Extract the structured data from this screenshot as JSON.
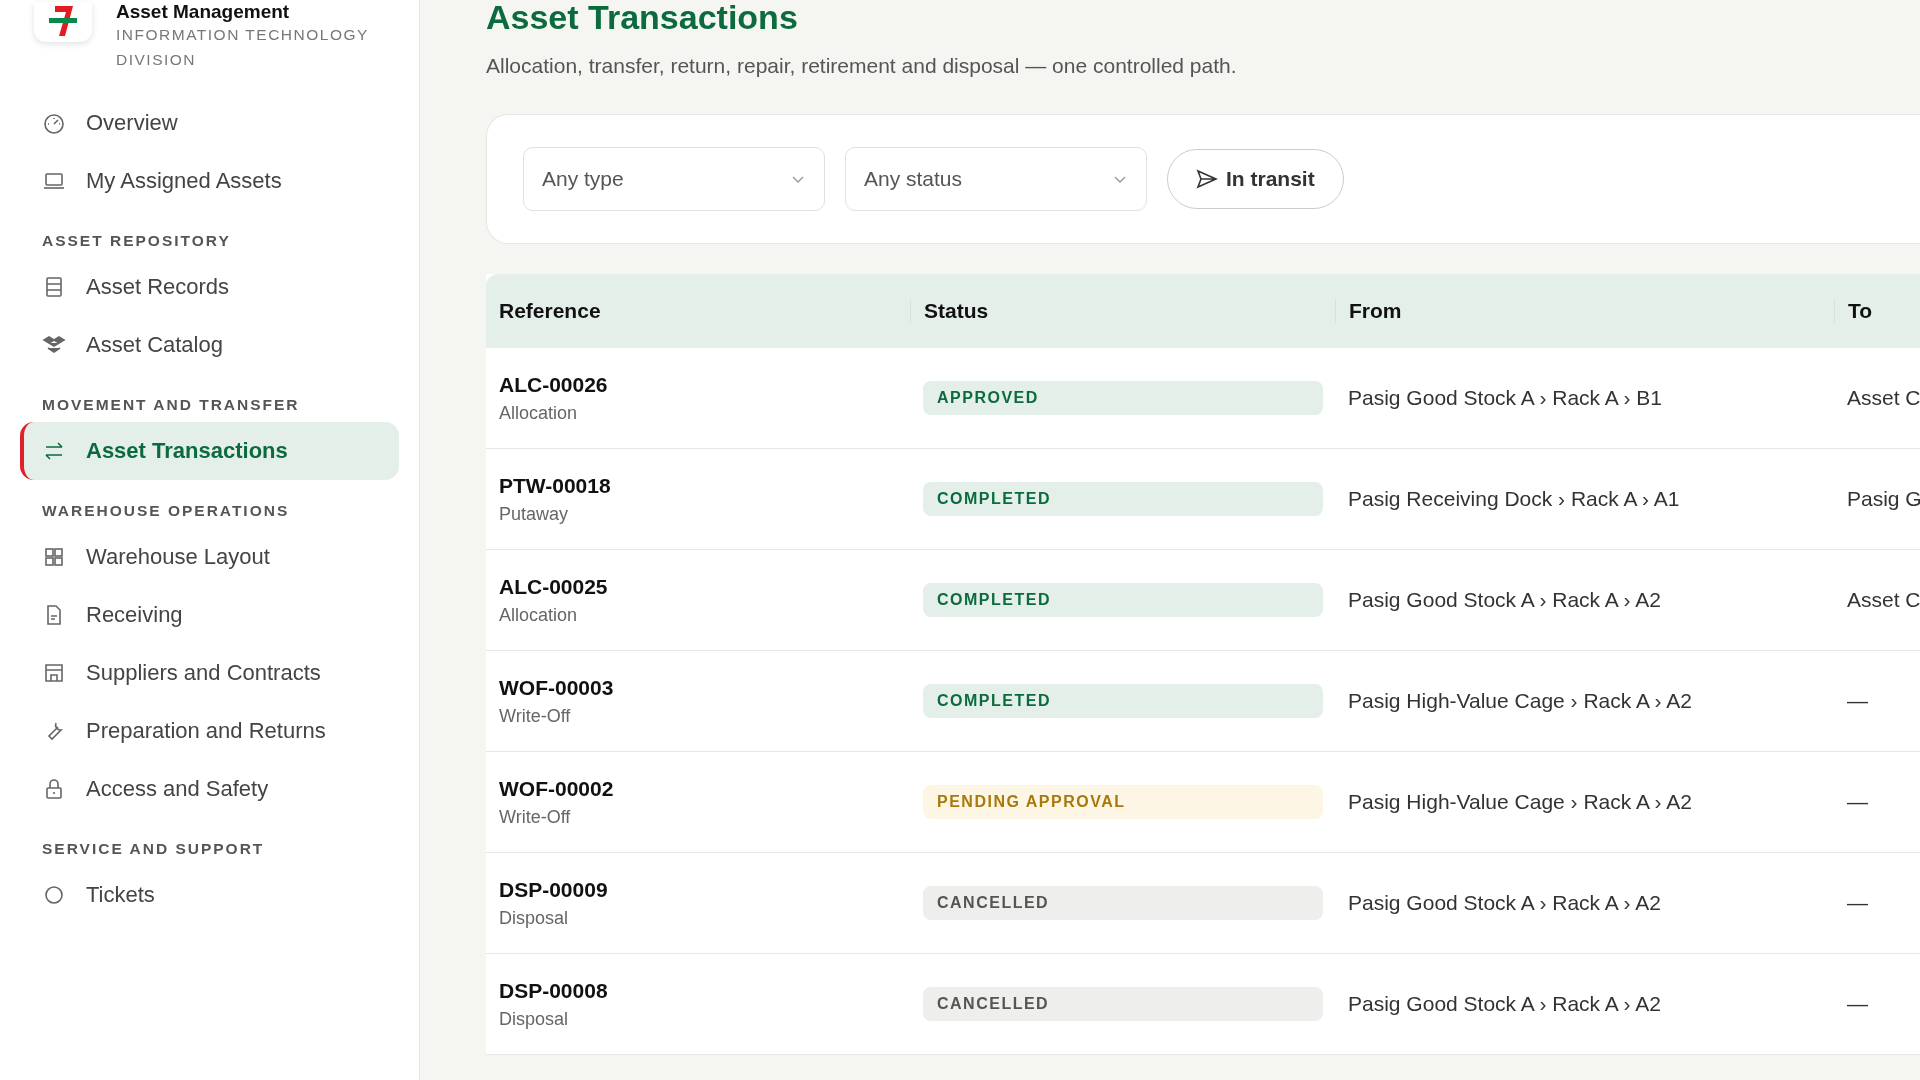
{
  "brand": {
    "title": "Asset Management",
    "subtitle": "INFORMATION TECHNOLOGY DIVISION"
  },
  "sidebar": {
    "items": [
      {
        "label": "Overview",
        "selected": false
      },
      {
        "label": "My Assigned Assets",
        "selected": false
      }
    ],
    "sections": [
      {
        "heading": "ASSET REPOSITORY",
        "items": [
          {
            "label": "Asset Records",
            "selected": false
          },
          {
            "label": "Asset Catalog",
            "selected": false
          }
        ]
      },
      {
        "heading": "MOVEMENT AND TRANSFER",
        "items": [
          {
            "label": "Asset Transactions",
            "selected": true
          }
        ]
      },
      {
        "heading": "WAREHOUSE OPERATIONS",
        "items": [
          {
            "label": "Warehouse Layout",
            "selected": false
          },
          {
            "label": "Receiving",
            "selected": false
          },
          {
            "label": "Suppliers and Contracts",
            "selected": false
          },
          {
            "label": "Preparation and Returns",
            "selected": false
          },
          {
            "label": "Access and Safety",
            "selected": false
          }
        ]
      },
      {
        "heading": "SERVICE AND SUPPORT",
        "items": [
          {
            "label": "Tickets",
            "selected": false
          }
        ]
      }
    ]
  },
  "page": {
    "title": "Asset Transactions",
    "subtitle": "Allocation, transfer, return, repair, retirement and disposal — one controlled path."
  },
  "filters": {
    "type_select": "Any type",
    "status_select": "Any status",
    "toggle": "In transit"
  },
  "table": {
    "columns": [
      "Reference",
      "Status",
      "From",
      "To"
    ],
    "rows": [
      {
        "reference": "ALC-00026",
        "type": "Allocation",
        "status": "APPROVED",
        "kind": "approved",
        "from": "Pasig Good Stock A › Rack A › B1",
        "to": "Asset C"
      },
      {
        "reference": "PTW-00018",
        "type": "Putaway",
        "status": "COMPLETED",
        "kind": "completed",
        "from": "Pasig Receiving Dock › Rack A › A1",
        "to": "Pasig G"
      },
      {
        "reference": "ALC-00025",
        "type": "Allocation",
        "status": "COMPLETED",
        "kind": "completed",
        "from": "Pasig Good Stock A › Rack A › A2",
        "to": "Asset C"
      },
      {
        "reference": "WOF-00003",
        "type": "Write-Off",
        "status": "COMPLETED",
        "kind": "completed",
        "from": "Pasig High-Value Cage › Rack A › A2",
        "to": "—"
      },
      {
        "reference": "WOF-00002",
        "type": "Write-Off",
        "status": "PENDING APPROVAL",
        "kind": "pending",
        "from": "Pasig High-Value Cage › Rack A › A2",
        "to": "—"
      },
      {
        "reference": "DSP-00009",
        "type": "Disposal",
        "status": "CANCELLED",
        "kind": "cancelled",
        "from": "Pasig Good Stock A › Rack A › A2",
        "to": "—"
      },
      {
        "reference": "DSP-00008",
        "type": "Disposal",
        "status": "CANCELLED",
        "kind": "cancelled",
        "from": "Pasig Good Stock A › Rack A › A2",
        "to": "—"
      }
    ]
  }
}
